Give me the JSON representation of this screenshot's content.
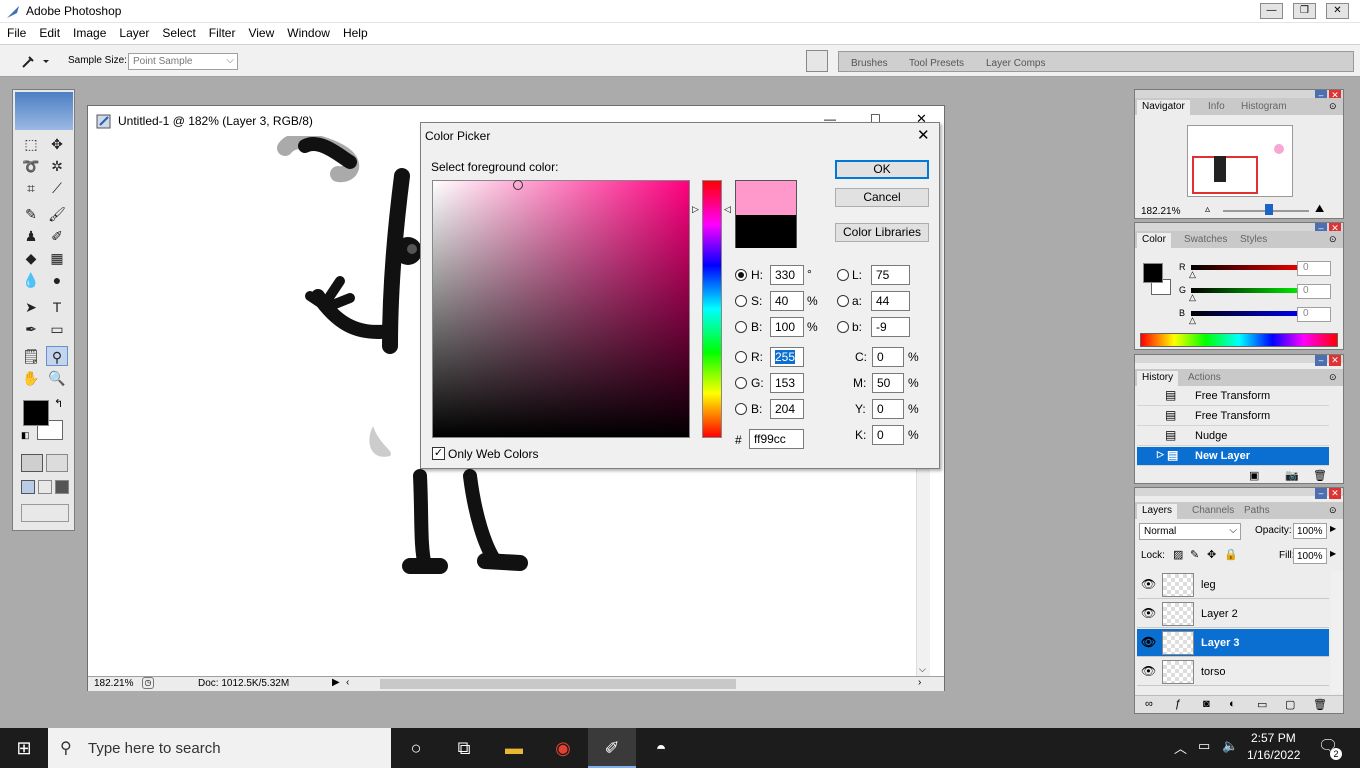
{
  "app": {
    "title": "Adobe Photoshop"
  },
  "menu": [
    "File",
    "Edit",
    "Image",
    "Layer",
    "Select",
    "Filter",
    "View",
    "Window",
    "Help"
  ],
  "options": {
    "sample_label": "Sample Size:",
    "sample_value": "Point Sample"
  },
  "wells": {
    "brushes": "Brushes",
    "tool_presets": "Tool Presets",
    "layer_comps": "Layer Comps"
  },
  "document": {
    "title": "Untitled-1 @ 182% (Layer 3, RGB/8)",
    "zoom": "182.21%",
    "doc_info": "Doc: 1012.5K/5.32M"
  },
  "picker": {
    "title": "Color Picker",
    "prompt": "Select foreground color:",
    "ok": "OK",
    "cancel": "Cancel",
    "libraries": "Color Libraries",
    "only_web": "Only Web Colors",
    "hsb": [
      {
        "label": "H:",
        "value": "330",
        "unit": "°"
      },
      {
        "label": "S:",
        "value": "40",
        "unit": "%"
      },
      {
        "label": "B:",
        "value": "100",
        "unit": "%"
      }
    ],
    "rgb": [
      {
        "label": "R:",
        "value": "255"
      },
      {
        "label": "G:",
        "value": "153"
      },
      {
        "label": "B:",
        "value": "204"
      }
    ],
    "lab": [
      {
        "label": "L:",
        "value": "75"
      },
      {
        "label": "a:",
        "value": "44"
      },
      {
        "label": "b:",
        "value": "-9"
      }
    ],
    "cmyk": [
      {
        "label": "C:",
        "value": "0",
        "unit": "%"
      },
      {
        "label": "M:",
        "value": "50",
        "unit": "%"
      },
      {
        "label": "Y:",
        "value": "0",
        "unit": "%"
      },
      {
        "label": "K:",
        "value": "0",
        "unit": "%"
      }
    ],
    "hex_label": "#",
    "hex": "ff99cc",
    "new_color": "#ff99cc",
    "old_color": "#000000"
  },
  "navigator": {
    "tabs": [
      "Navigator",
      "Info",
      "Histogram"
    ],
    "zoom": "182.21%"
  },
  "color": {
    "tabs": [
      "Color",
      "Swatches",
      "Styles"
    ],
    "sliders": [
      {
        "label": "R",
        "value": "0"
      },
      {
        "label": "G",
        "value": "0"
      },
      {
        "label": "B",
        "value": "0"
      }
    ]
  },
  "history": {
    "tabs": [
      "History",
      "Actions"
    ],
    "items": [
      "Free Transform",
      "Free Transform",
      "Nudge",
      "New Layer"
    ]
  },
  "layers": {
    "tabs": [
      "Layers",
      "Channels",
      "Paths"
    ],
    "blend": "Normal",
    "opacity_label": "Opacity:",
    "opacity": "100%",
    "lock_label": "Lock:",
    "fill_label": "Fill:",
    "fill": "100%",
    "items": [
      "leg",
      "Layer 2",
      "Layer 3",
      "torso"
    ]
  },
  "taskbar": {
    "search": "Type here to search",
    "time": "2:57 PM",
    "date": "1/16/2022",
    "notifications": "2"
  },
  "colors": {
    "selection": "#0a6fd0",
    "accent_blue": "#0078d7"
  }
}
